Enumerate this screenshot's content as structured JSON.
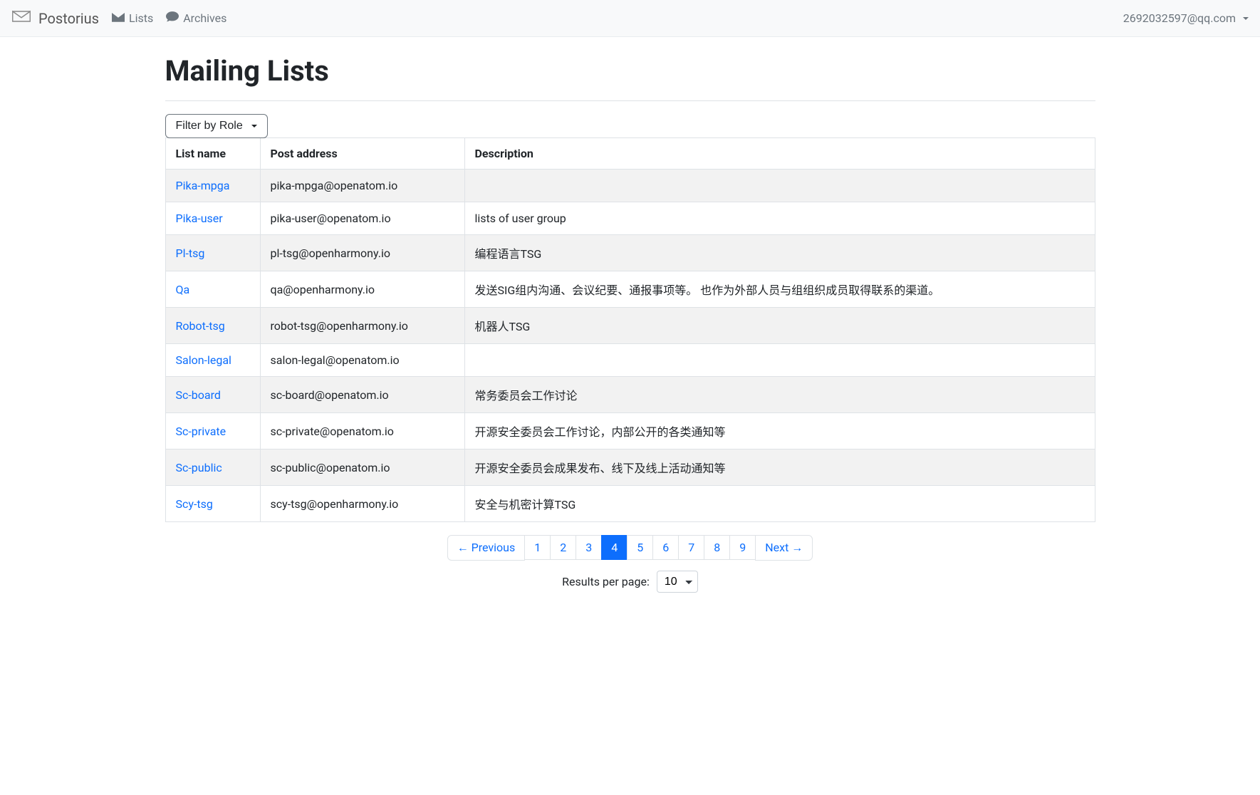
{
  "brand": "Postorius",
  "nav": {
    "lists": "Lists",
    "archives": "Archives",
    "user_email": "2692032597@qq.com"
  },
  "page_title": "Mailing Lists",
  "filter_button_label": "Filter by Role",
  "table": {
    "headers": {
      "name": "List name",
      "post": "Post address",
      "desc": "Description"
    },
    "rows": [
      {
        "name": "Pika-mpga",
        "post": "pika-mpga@openatom.io",
        "desc": ""
      },
      {
        "name": "Pika-user",
        "post": "pika-user@openatom.io",
        "desc": "lists of user group"
      },
      {
        "name": "Pl-tsg",
        "post": "pl-tsg@openharmony.io",
        "desc": "编程语言TSG"
      },
      {
        "name": "Qa",
        "post": "qa@openharmony.io",
        "desc": "发送SIG组内沟通、会议纪要、通报事项等。 也作为外部人员与组组织成员取得联系的渠道。"
      },
      {
        "name": "Robot-tsg",
        "post": "robot-tsg@openharmony.io",
        "desc": "机器人TSG"
      },
      {
        "name": "Salon-legal",
        "post": "salon-legal@openatom.io",
        "desc": ""
      },
      {
        "name": "Sc-board",
        "post": "sc-board@openatom.io",
        "desc": "常务委员会工作讨论"
      },
      {
        "name": "Sc-private",
        "post": "sc-private@openatom.io",
        "desc": "开源安全委员会工作讨论，内部公开的各类通知等"
      },
      {
        "name": "Sc-public",
        "post": "sc-public@openatom.io",
        "desc": "开源安全委员会成果发布、线下及线上活动通知等"
      },
      {
        "name": "Scy-tsg",
        "post": "scy-tsg@openharmony.io",
        "desc": "安全与机密计算TSG"
      }
    ]
  },
  "pagination": {
    "prev_label": "← Previous",
    "next_label": "Next →",
    "pages": [
      "1",
      "2",
      "3",
      "4",
      "5",
      "6",
      "7",
      "8",
      "9"
    ],
    "active_index": 3
  },
  "results_per_page": {
    "label": "Results per page:",
    "selected": "10"
  }
}
